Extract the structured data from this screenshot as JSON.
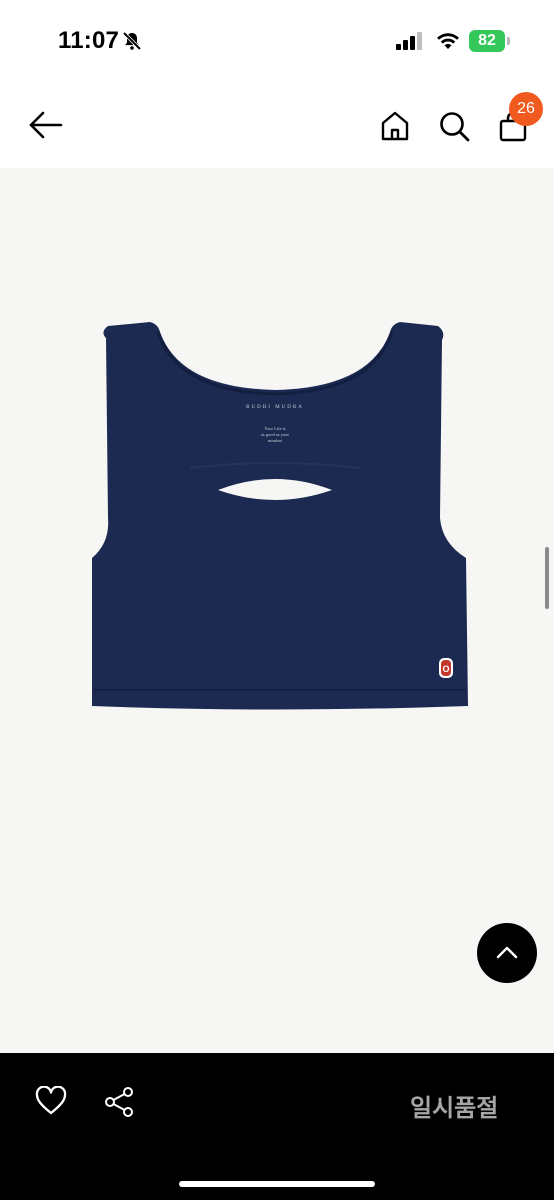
{
  "status_bar": {
    "time": "11:07",
    "battery_level": "82",
    "icons": [
      "bell-slash-icon",
      "signal-icon",
      "wifi-icon",
      "battery-icon"
    ]
  },
  "nav": {
    "icons": [
      "back-arrow-icon",
      "home-icon",
      "search-icon",
      "shopping-bag-icon"
    ],
    "cart_count": "26"
  },
  "product": {
    "label_brand": "BUDHI MUDRA",
    "label_tagline": [
      "Your Life is",
      "as good as your",
      "mindset"
    ],
    "patch_text": "O",
    "image_color": "#1c2a52"
  },
  "scroll_top_icon": "chevron-up-icon",
  "bottom_bar": {
    "icons": [
      "heart-icon",
      "share-icon"
    ],
    "status_text": "일시품절"
  },
  "colors": {
    "badge": "#f15a1f",
    "battery": "#34c759",
    "product_bg": "#f6f6f5",
    "bottom_bar": "#000000"
  }
}
